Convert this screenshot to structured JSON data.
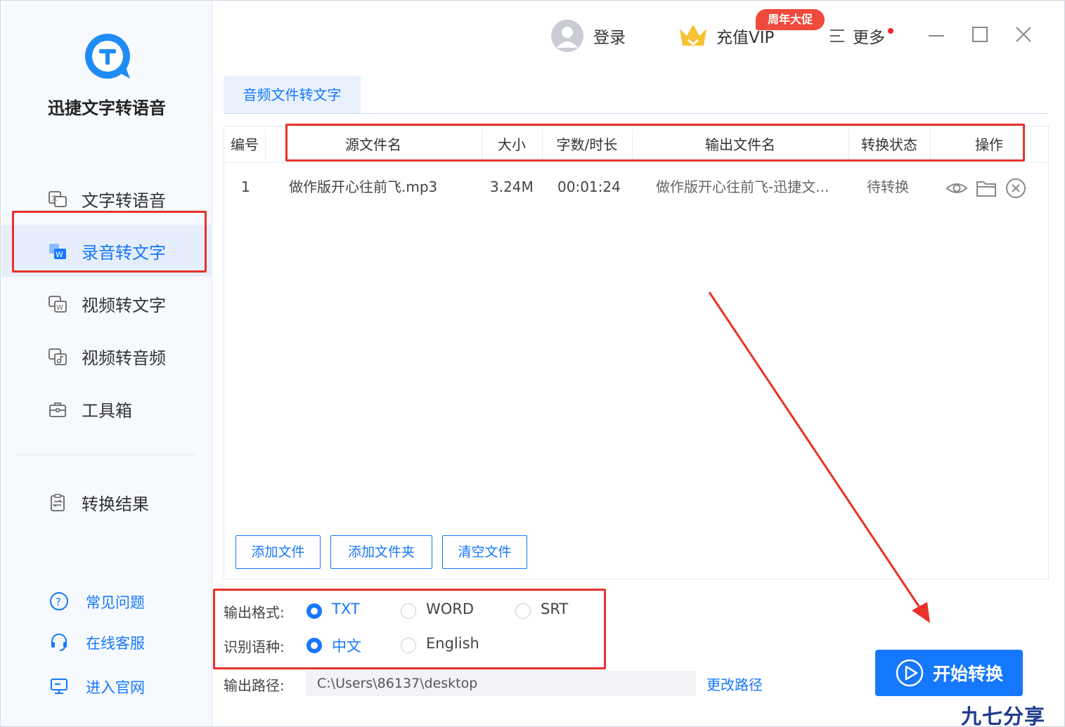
{
  "app": {
    "title": "迅捷文字转语音"
  },
  "sidebar": {
    "items": [
      {
        "label": "文字转语音",
        "icon": "text-to-speech-icon",
        "active": false
      },
      {
        "label": "录音转文字",
        "icon": "audio-to-text-icon",
        "active": true
      },
      {
        "label": "视频转文字",
        "icon": "video-to-text-icon",
        "active": false
      },
      {
        "label": "视频转音频",
        "icon": "video-to-audio-icon",
        "active": false
      },
      {
        "label": "工具箱",
        "icon": "toolbox-icon",
        "active": false
      }
    ],
    "results_label": "转换结果",
    "footer": [
      {
        "label": "常见问题",
        "icon": "help-icon"
      },
      {
        "label": "在线客服",
        "icon": "headset-icon"
      },
      {
        "label": "进入官网",
        "icon": "monitor-icon"
      }
    ]
  },
  "topbar": {
    "login": "登录",
    "vip": "充值VIP",
    "promo": "周年大促",
    "more": "更多"
  },
  "tabs": [
    {
      "label": "音频文件转文字",
      "active": true
    }
  ],
  "table": {
    "columns": [
      "编号",
      "源文件名",
      "大小",
      "字数/时长",
      "输出文件名",
      "转换状态",
      "操作"
    ],
    "rows": [
      {
        "index": "1",
        "source": "做作版开心往前飞.mp3",
        "size": "3.24M",
        "duration": "00:01:24",
        "output": "做作版开心往前飞-迅捷文...",
        "status": "待转换"
      }
    ]
  },
  "buttons": {
    "add_file": "添加文件",
    "add_folder": "添加文件夹",
    "clear": "清空文件",
    "start": "开始转换",
    "change_path": "更改路径"
  },
  "options": {
    "format_label": "输出格式:",
    "formats": [
      "TXT",
      "WORD",
      "SRT"
    ],
    "selected_format": "TXT",
    "language_label": "识别语种:",
    "languages": [
      "中文",
      "English"
    ],
    "selected_language": "中文"
  },
  "output": {
    "path_label": "输出路径:",
    "path": "C:\\Users\\86137\\desktop"
  },
  "watermark": "九七分享吧",
  "colors": {
    "accent": "#1677ff",
    "annotation": "#e8322a",
    "sidebar_bg": "#f6f9fd",
    "active_bg": "#e6eefb"
  }
}
